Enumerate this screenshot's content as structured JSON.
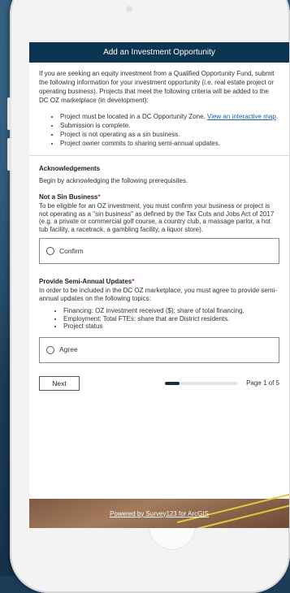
{
  "header": {
    "title": "Add an Investment Opportunity"
  },
  "intro": {
    "text": "If you are seeking an equity investment from a Qualified Opportunity Fund, submit the following information for your investment opportunity (i.e. real estate project or operating business). Projects that meet the following criteria will be added to the DC OZ marketplace (in development):",
    "criteria_1_text": "Project must be located in a DC Opportunity Zone.",
    "criteria_1_link": "View an interactive map",
    "criteria_1_end": ".",
    "criteria_2": "Submission is complete.",
    "criteria_3": "Project is not operating as a sin business.",
    "criteria_4": "Project owner commits to sharing semi-annual updates."
  },
  "acknowledgements": {
    "title": "Acknowledgements",
    "text": "Begin by acknowledging the following prerequisites."
  },
  "q1": {
    "title": "Not a Sin Business",
    "required_mark": "*",
    "description": "To be eligible for an OZ investment, you must confirm your business or project is not operating as a \"sin business\" as defined by the Tax Cuts and Jobs Act of 2017 (e.g. a private or commercial golf course, a country club, a massage parlor, a hot tub facility, a racetrack, a gambling facility, a liquor store).",
    "option": "Confirm"
  },
  "q2": {
    "title": "Provide Semi-Annual Updates",
    "required_mark": "*",
    "description": "In order to be included in the DC OZ marketplace, you must agree to provide semi-annual updates on the following topics:",
    "topic_1": "Financing: OZ investment received ($); share of total financing.",
    "topic_2": "Employment: Total FTEs; share that are District residents.",
    "topic_3": "Project status",
    "option": "Agree"
  },
  "footer": {
    "next_label": "Next",
    "page_label": "Page 1 of 5",
    "progress_fraction": 0.2,
    "powered_by": "Powered by Survey123 for ArcGIS"
  }
}
